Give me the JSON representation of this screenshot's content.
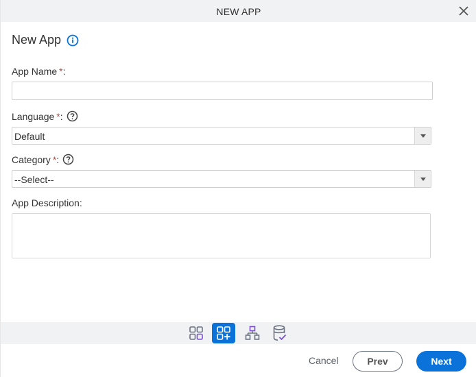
{
  "dialog": {
    "title": "NEW APP",
    "close_icon": "close-icon"
  },
  "form": {
    "heading": "New App",
    "heading_icon": "info-icon",
    "app_name": {
      "label": "App Name",
      "required_mark": "*",
      "colon": ":",
      "value": ""
    },
    "language": {
      "label": "Language",
      "required_mark": "*",
      "colon": ":",
      "help_icon": "help-icon",
      "selected": "Default"
    },
    "category": {
      "label": "Category",
      "required_mark": "*",
      "colon": ":",
      "help_icon": "help-icon",
      "selected": "--Select--"
    },
    "description": {
      "label": "App Description:",
      "value": ""
    }
  },
  "steps": [
    {
      "name": "app-settings",
      "icon": "grid-icon",
      "active": false
    },
    {
      "name": "new-app",
      "icon": "grid-plus-icon",
      "active": true
    },
    {
      "name": "hierarchy",
      "icon": "hierarchy-icon",
      "active": false
    },
    {
      "name": "database",
      "icon": "database-check-icon",
      "active": false
    }
  ],
  "footer": {
    "cancel_label": "Cancel",
    "prev_label": "Prev",
    "next_label": "Next"
  },
  "colors": {
    "accent": "#0b72d9",
    "required": "#a0504a",
    "step_highlight": "#7a4fd6"
  }
}
